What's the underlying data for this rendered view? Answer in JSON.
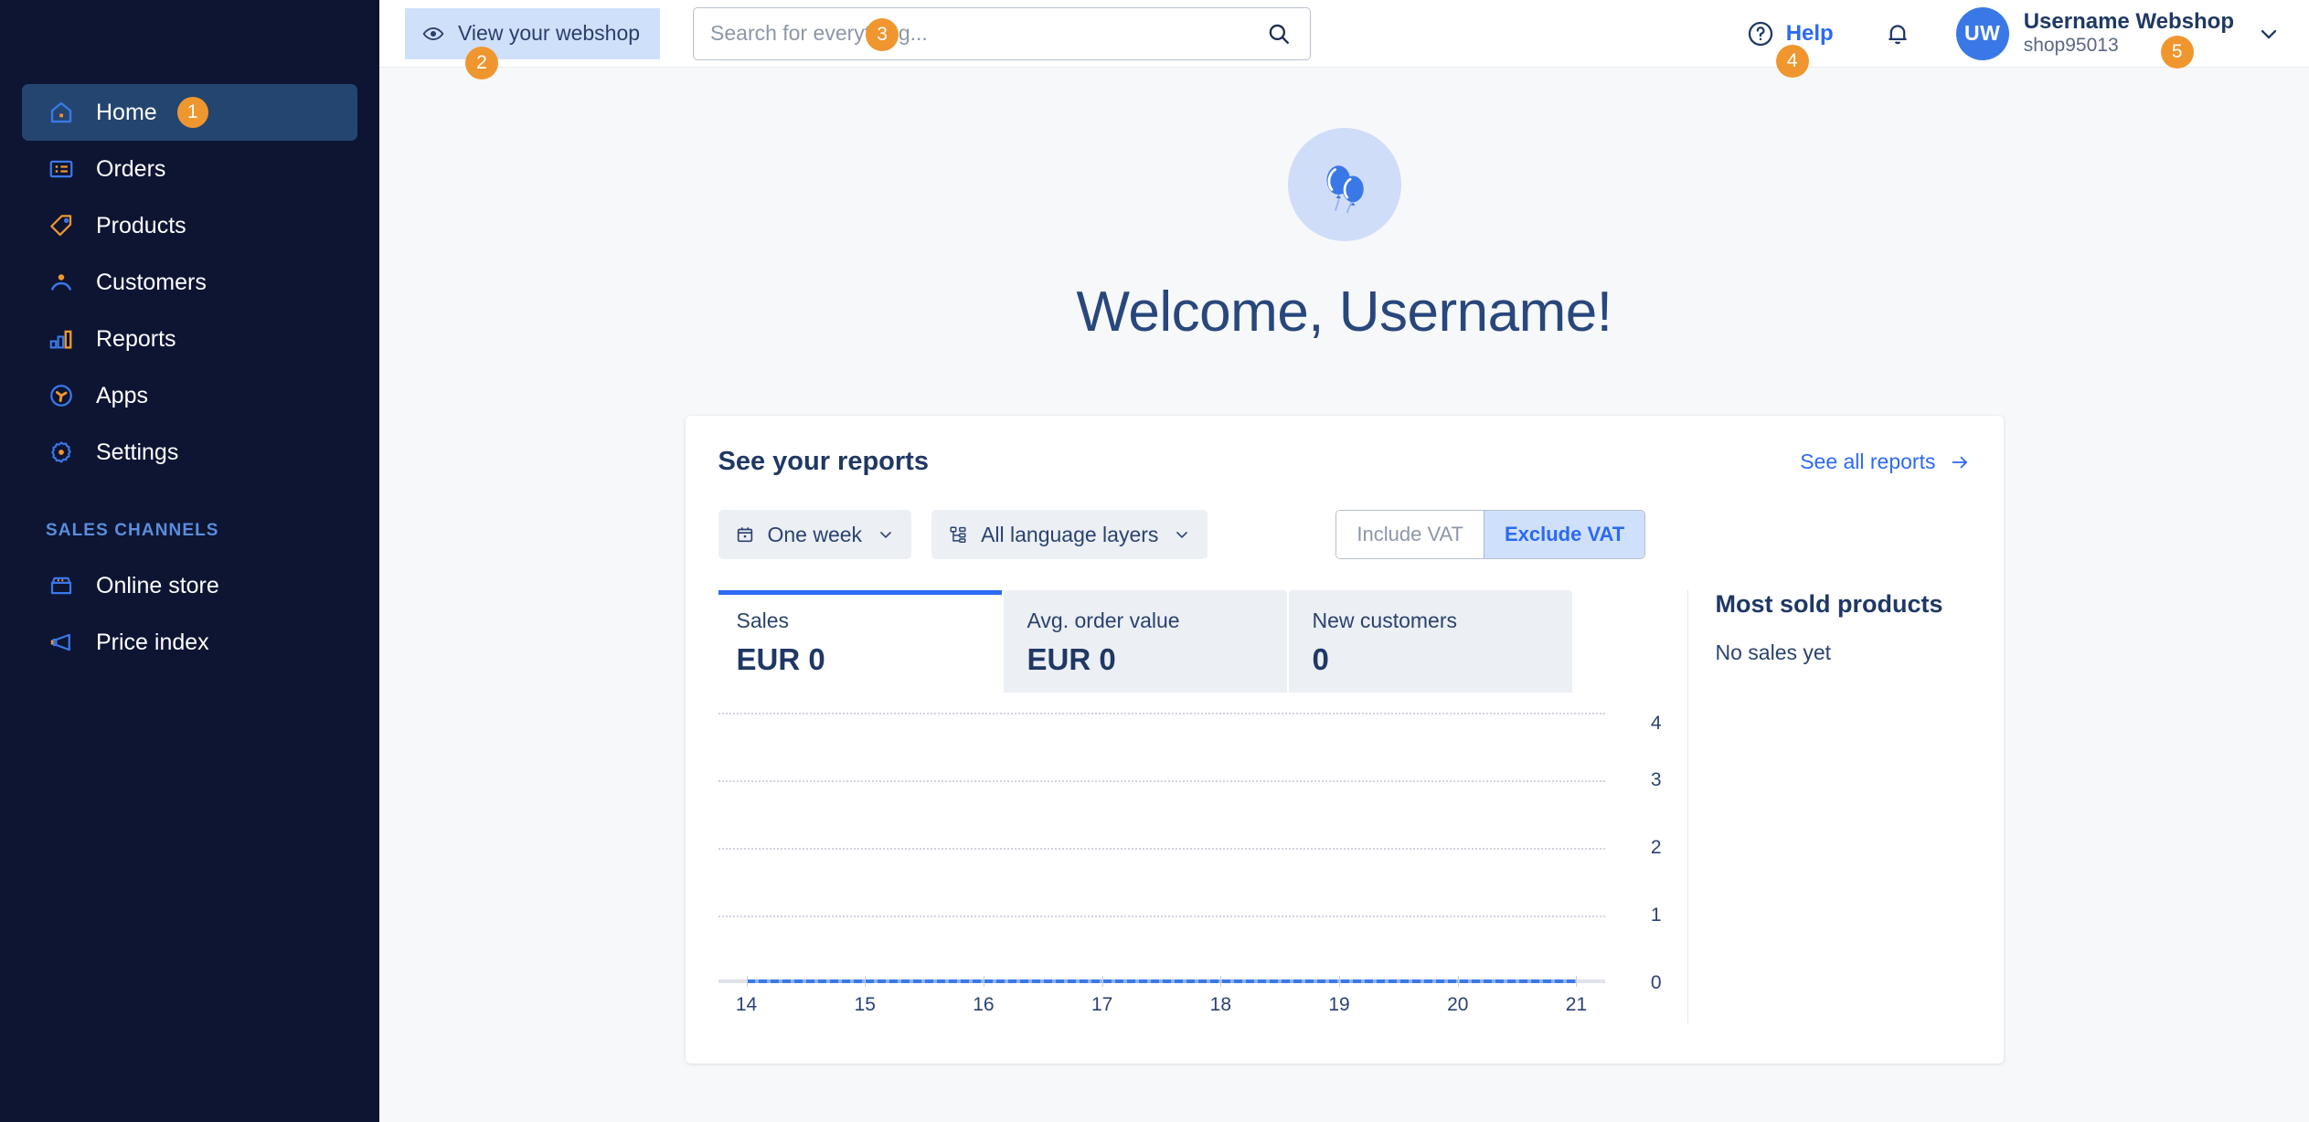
{
  "sidebar": {
    "items": [
      {
        "label": "Home",
        "icon": "home-icon",
        "badge": "1",
        "active": true
      },
      {
        "label": "Orders",
        "icon": "orders-icon",
        "badge": "",
        "active": false
      },
      {
        "label": "Products",
        "icon": "products-tag-icon",
        "badge": "",
        "active": false
      },
      {
        "label": "Customers",
        "icon": "customers-icon",
        "badge": "",
        "active": false
      },
      {
        "label": "Reports",
        "icon": "reports-bar-icon",
        "badge": "",
        "active": false
      },
      {
        "label": "Apps",
        "icon": "apps-icon",
        "badge": "",
        "active": false
      },
      {
        "label": "Settings",
        "icon": "gear-icon",
        "badge": "",
        "active": false
      }
    ],
    "section_title": "SALES CHANNELS",
    "channels": [
      {
        "label": "Online store",
        "icon": "store-icon"
      },
      {
        "label": "Price index",
        "icon": "megaphone-icon"
      }
    ]
  },
  "topbar": {
    "view_webshop_label": "View your webshop",
    "view_webshop_badge": "2",
    "search_placeholder": "Search for everything...",
    "search_value": "",
    "search_badge": "3",
    "help_label": "Help",
    "help_badge": "4",
    "avatar_initials": "UW",
    "user_name": "Username Webshop",
    "user_shop": "shop95013",
    "user_badge": "5"
  },
  "hero": {
    "icon": "balloons-icon",
    "title": "Welcome, Username!"
  },
  "reports": {
    "title": "See your reports",
    "see_all_label": "See all reports",
    "period_filter": "One week",
    "period_icon": "calendar-icon",
    "language_filter": "All language layers",
    "language_icon": "layers-icon",
    "vat_options": [
      {
        "label": "Include VAT",
        "selected": false
      },
      {
        "label": "Exclude VAT",
        "selected": true
      }
    ],
    "metrics": [
      {
        "label": "Sales",
        "value": "EUR 0",
        "active": true
      },
      {
        "label": "Avg. order value",
        "value": "EUR 0",
        "active": false
      },
      {
        "label": "New customers",
        "value": "0",
        "active": false
      }
    ],
    "most_sold_title": "Most sold products",
    "most_sold_empty": "No sales yet"
  },
  "chart_data": {
    "type": "line",
    "title": "Sales",
    "xlabel": "",
    "ylabel": "",
    "categories": [
      "14",
      "15",
      "16",
      "17",
      "18",
      "19",
      "20",
      "21"
    ],
    "x": [
      14,
      15,
      16,
      17,
      18,
      19,
      20,
      21
    ],
    "series": [
      {
        "name": "Sales",
        "values": [
          0,
          0,
          0,
          0,
          0,
          0,
          0,
          0
        ],
        "color": "#3b78e7"
      }
    ],
    "yticks": [
      "0",
      "1",
      "2",
      "3",
      "4"
    ],
    "ylim": [
      0,
      4
    ],
    "xlim": [
      14,
      21
    ],
    "grid": true,
    "legend": "none"
  },
  "colors": {
    "sidebar_bg": "#0d1533",
    "sidebar_active": "#24456f",
    "accent_blue": "#2b6af3",
    "accent_orange": "#f0962f",
    "heading": "#1f3864",
    "page_bg": "#f7f8fa"
  }
}
